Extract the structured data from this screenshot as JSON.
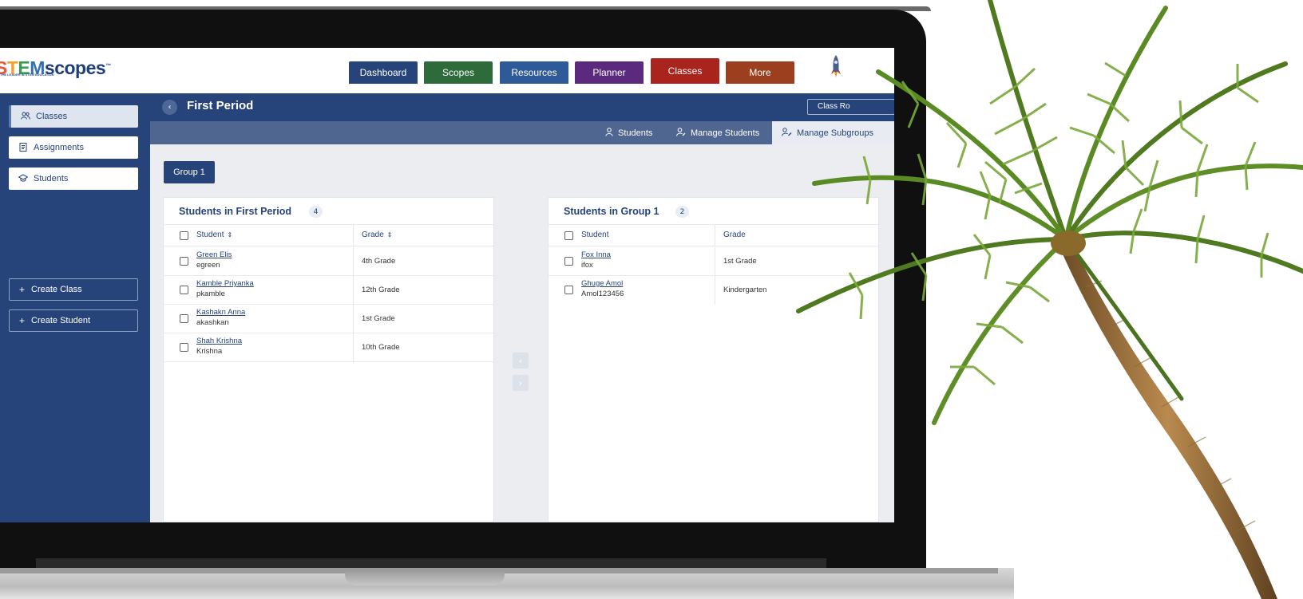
{
  "logo": {
    "brand_a": "S",
    "brand_b": "T",
    "brand_c": "E",
    "brand_d": "M",
    "brand_e": "scopes",
    "tm": "™",
    "tagline": "THE LEADER IN STEM EDUCATION"
  },
  "nav": {
    "items": [
      {
        "label": "Dashboard",
        "color": "#26447a"
      },
      {
        "label": "Scopes",
        "color": "#2e6b3a"
      },
      {
        "label": "Resources",
        "color": "#2f5a9a"
      },
      {
        "label": "Planner",
        "color": "#5b2a7e"
      },
      {
        "label": "Classes",
        "color": "#a8241c"
      },
      {
        "label": "More",
        "color": "#9c3f1f"
      }
    ]
  },
  "sidebar": {
    "items": [
      {
        "label": "Classes",
        "icon": "users-icon"
      },
      {
        "label": "Assignments",
        "icon": "document-icon"
      },
      {
        "label": "Students",
        "icon": "graduation-cap-icon"
      }
    ],
    "actions": [
      {
        "label": "Create Class"
      },
      {
        "label": "Create Student"
      }
    ]
  },
  "class_header": {
    "title": "First Period",
    "roster_button": "Class Ro"
  },
  "tabs": [
    {
      "label": "Students"
    },
    {
      "label": "Manage Students"
    },
    {
      "label": "Manage Subgroups"
    }
  ],
  "group_button": "Group 1",
  "left_panel": {
    "title": "Students in First Period",
    "count": "4",
    "col_student": "Student",
    "col_grade": "Grade",
    "rows": [
      {
        "name": "Green Elis",
        "username": "egreen",
        "grade": "4th Grade"
      },
      {
        "name": "Kamble Priyanka",
        "username": "pkamble",
        "grade": "12th Grade"
      },
      {
        "name": "Kashakn Anna",
        "username": "akashkan",
        "grade": "1st Grade"
      },
      {
        "name": "Shah Krishna",
        "username": "Krishna",
        "grade": "10th Grade"
      }
    ]
  },
  "right_panel": {
    "title": "Students in Group 1",
    "count": "2",
    "col_student": "Student",
    "col_grade": "Grade",
    "rows": [
      {
        "name": "Fox Inna",
        "username": "ifox",
        "grade": "1st Grade"
      },
      {
        "name": "Ghuge Amol",
        "username": "Amol123456",
        "grade": "Kindergarten"
      }
    ]
  },
  "transfer": {
    "left": "‹",
    "right": "›"
  },
  "colors": {
    "primary": "#26447a",
    "tab_bar": "#4f6690",
    "background": "#ecedf0"
  }
}
